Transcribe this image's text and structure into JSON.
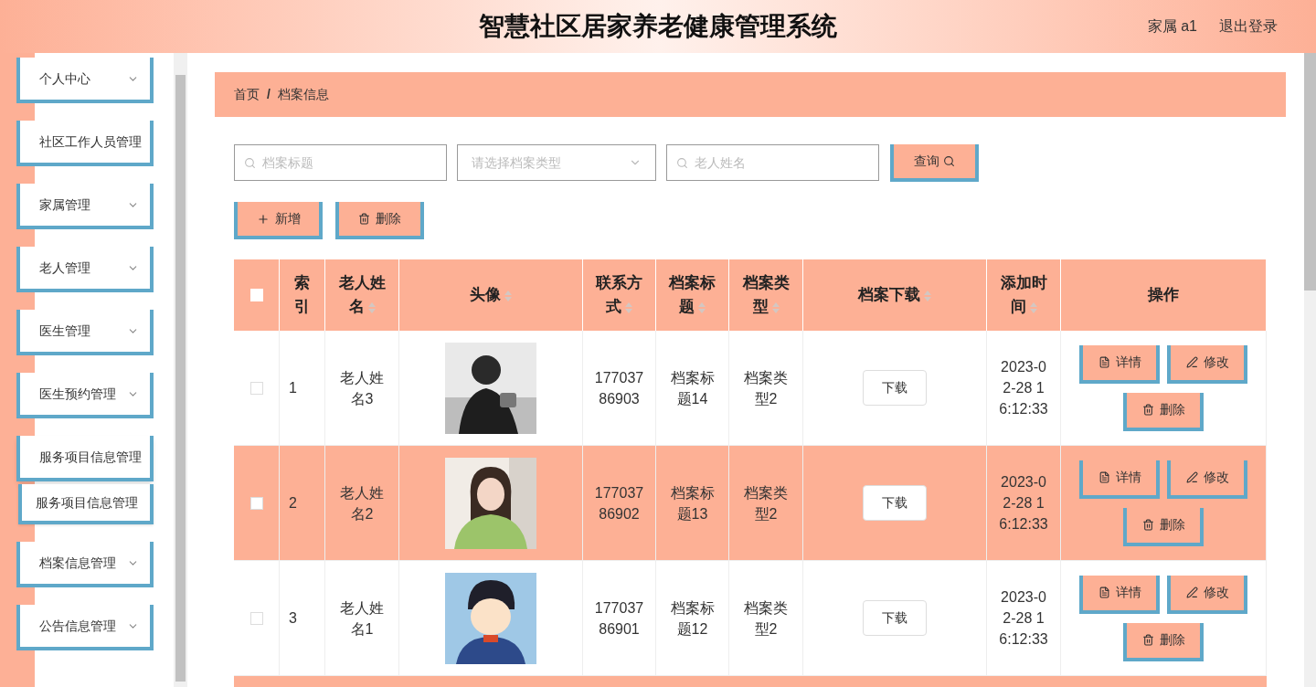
{
  "header": {
    "title": "智慧社区居家养老健康管理系统",
    "user": "家属 a1",
    "logout": "退出登录"
  },
  "sidebar": {
    "items": [
      {
        "label": "个人中心",
        "kind": "submenu",
        "expanded": false
      },
      {
        "label": "社区工作人员管理",
        "kind": "link",
        "expanded": false
      },
      {
        "label": "家属管理",
        "kind": "submenu",
        "expanded": false
      },
      {
        "label": "老人管理",
        "kind": "submenu",
        "expanded": false
      },
      {
        "label": "医生管理",
        "kind": "submenu",
        "expanded": false
      },
      {
        "label": "医生预约管理",
        "kind": "submenu",
        "expanded": false
      },
      {
        "label": "服务项目信息管理",
        "kind": "submenu",
        "expanded": true,
        "children": [
          {
            "label": "服务项目信息管理"
          }
        ]
      },
      {
        "label": "档案信息管理",
        "kind": "submenu",
        "expanded": false
      },
      {
        "label": "公告信息管理",
        "kind": "submenu",
        "expanded": false
      }
    ]
  },
  "breadcrumb": {
    "items": [
      "首页",
      "档案信息"
    ],
    "separator": "/"
  },
  "filters": {
    "title_field": {
      "placeholder": "档案标题"
    },
    "type_select": {
      "placeholder": "请选择档案类型"
    },
    "name_field": {
      "placeholder": "老人姓名"
    },
    "search_button": "查询"
  },
  "actions": [
    {
      "kind": "add",
      "label": "新增"
    },
    {
      "kind": "delete",
      "label": "删除"
    }
  ],
  "table": {
    "select_all": {
      "checked": false
    },
    "columns": [
      {
        "label": "索引",
        "sortable": false
      },
      {
        "label": "老人姓名",
        "sortable": true
      },
      {
        "label": "头像",
        "sortable": true
      },
      {
        "label": "联系方式",
        "sortable": true
      },
      {
        "label": "档案标题",
        "sortable": true
      },
      {
        "label": "档案类型",
        "sortable": true
      },
      {
        "label": "档案下载",
        "sortable": true
      },
      {
        "label": "添加时间",
        "sortable": true
      },
      {
        "label": "操作",
        "sortable": false
      }
    ],
    "rows": [
      {
        "checked": false,
        "index": "1",
        "name": "老人姓名3",
        "phone": "17703786903",
        "title": "档案标题14",
        "type": "档案类型2",
        "download": "下载",
        "time": "2023-02-28 16:12:33",
        "buttons": [
          {
            "kind": "detail",
            "label": "详情"
          },
          {
            "kind": "edit",
            "label": "修改"
          },
          {
            "kind": "delete",
            "label": "删除"
          }
        ]
      },
      {
        "checked": false,
        "index": "2",
        "name": "老人姓名2",
        "phone": "17703786902",
        "title": "档案标题13",
        "type": "档案类型2",
        "download": "下载",
        "time": "2023-02-28 16:12:33",
        "buttons": [
          {
            "kind": "detail",
            "label": "详情"
          },
          {
            "kind": "edit",
            "label": "修改"
          },
          {
            "kind": "delete",
            "label": "删除"
          }
        ]
      },
      {
        "checked": false,
        "index": "3",
        "name": "老人姓名1",
        "phone": "17703786901",
        "title": "档案标题12",
        "type": "档案类型2",
        "download": "下载",
        "time": "2023-02-28 16:12:33",
        "buttons": [
          {
            "kind": "detail",
            "label": "详情"
          },
          {
            "kind": "edit",
            "label": "修改"
          },
          {
            "kind": "delete",
            "label": "删除"
          }
        ]
      }
    ]
  }
}
